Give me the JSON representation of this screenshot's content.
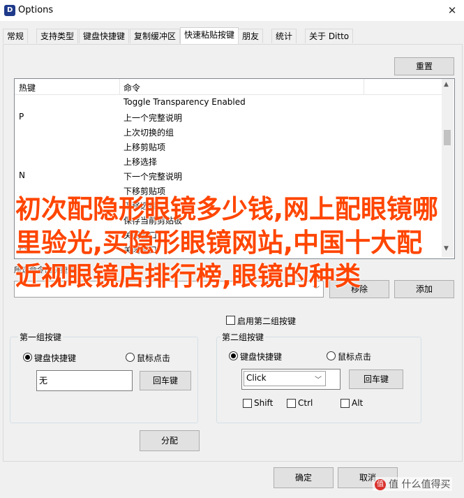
{
  "window": {
    "title": "Options",
    "close_symbol": "✕"
  },
  "tabs": [
    "常规",
    "支持类型",
    "键盘快捷键",
    "复制缓冲区",
    "快速粘贴按键",
    "朋友",
    "统计",
    "关于 Ditto"
  ],
  "active_tab": "快速粘贴按键",
  "reset_label": "重置",
  "list": {
    "header": {
      "hotkey": "热键",
      "command": "命令"
    },
    "rows": [
      {
        "hotkey": "",
        "command": "Toggle Transparency Enabled"
      },
      {
        "hotkey": "P",
        "command": "上一个完整说明"
      },
      {
        "hotkey": "",
        "command": "上次切换的组"
      },
      {
        "hotkey": "",
        "command": "上移剪贴项"
      },
      {
        "hotkey": "",
        "command": "上移选择"
      },
      {
        "hotkey": "N",
        "command": "下一个完整说明"
      },
      {
        "hotkey": "",
        "command": "下移剪贴项"
      },
      {
        "hotkey": "",
        "command": "下移选择"
      },
      {
        "hotkey": "",
        "command": "保存当前剪贴板"
      },
      {
        "hotkey": "",
        "command": "关闭窗口"
      },
      {
        "hotkey": "Esc",
        "command": "关闭窗口"
      }
    ]
  },
  "command_label": "所选命令的快捷键",
  "remove_label": "移除",
  "add_label": "添加",
  "enable_second_label": "启用第二组按键",
  "group1": {
    "title": "第一组按键",
    "keyboard": "键盘快捷键",
    "mouse": "鼠标点击",
    "value": "无",
    "enter": "回车键"
  },
  "group2": {
    "title": "第二组按键",
    "keyboard": "键盘快捷键",
    "mouse": "鼠标点击",
    "value": "Click",
    "enter": "回车键",
    "shift": "Shift",
    "ctrl": "Ctrl",
    "alt": "Alt"
  },
  "assign_label": "分配",
  "ok_label": "确定",
  "cancel_label": "取消",
  "overlay_text": "初次配隐形眼镜多少钱,网上配眼镜哪里验光,买隐形眼镜网站,中国十大配近视眼镜店排行榜,眼镜的种类",
  "watermark": "值 什么值得买",
  "watermark_logo": "值"
}
